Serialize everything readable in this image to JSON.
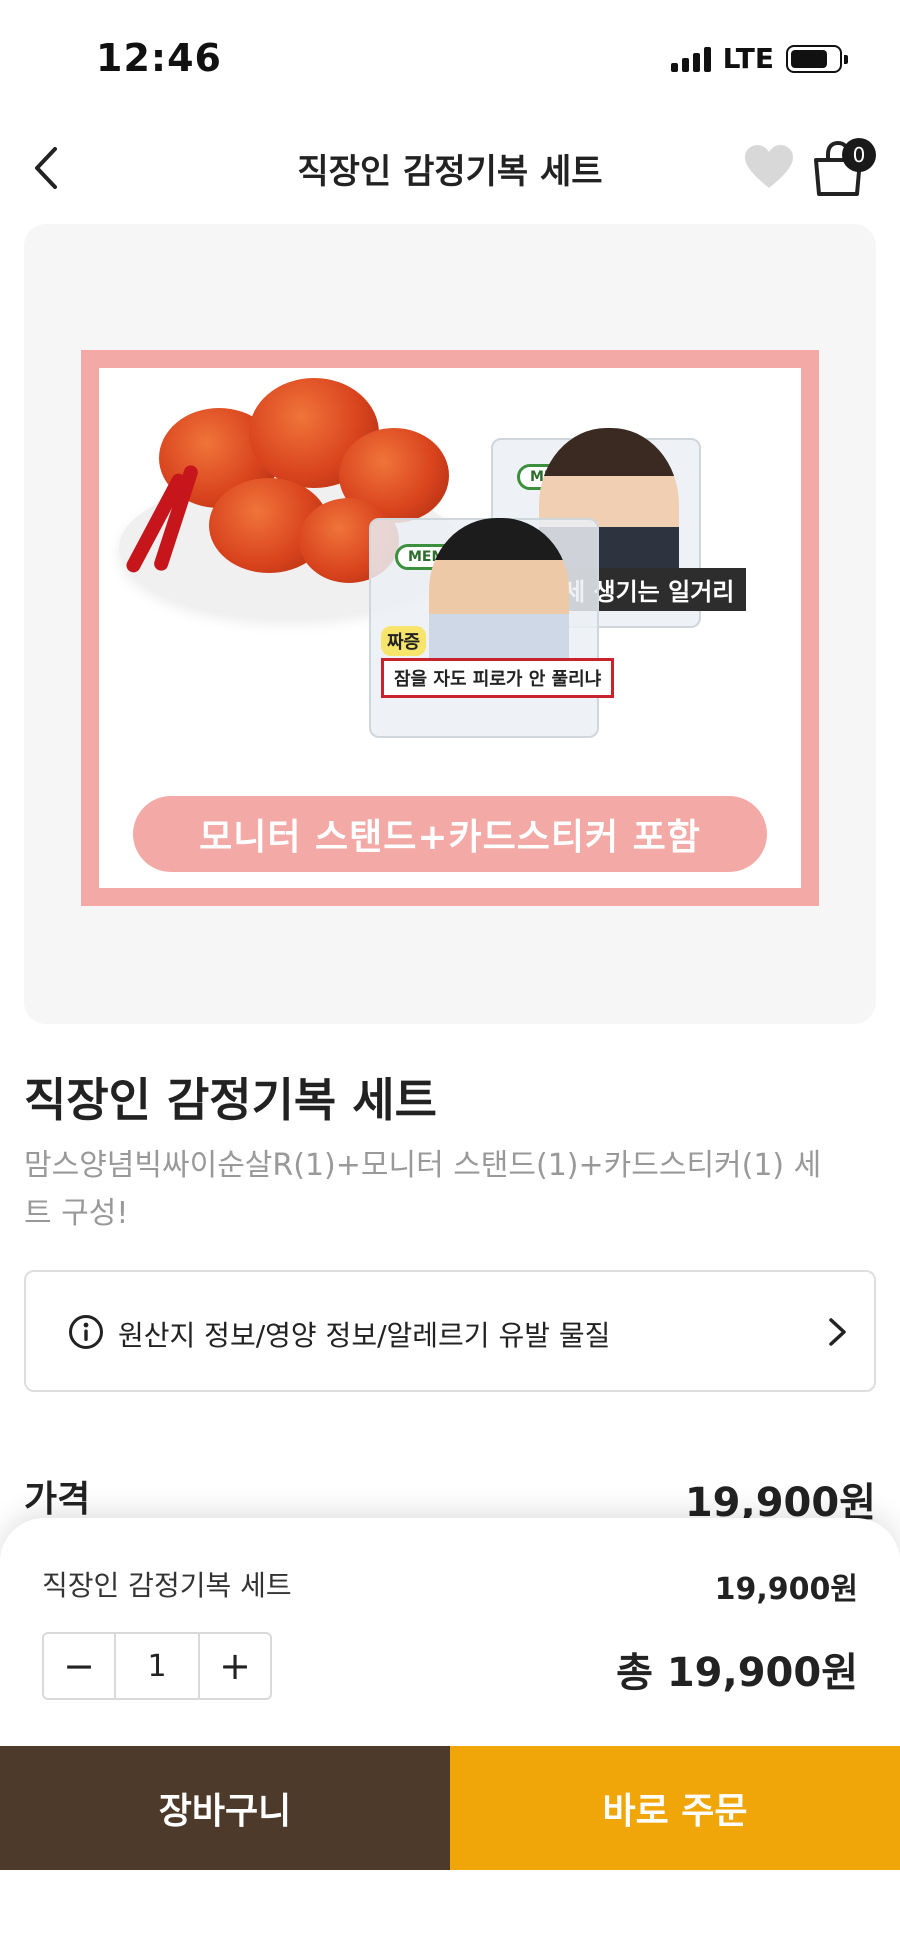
{
  "status_bar": {
    "time": "12:46",
    "network": "LTE"
  },
  "header": {
    "title": "직장인 감정기복 세트",
    "cart_count": "0"
  },
  "hero": {
    "memo_tag": "MEMO",
    "stand_label_1": "잠을 자도 피로가 안 풀리냐",
    "stand_badge_1": "짜증",
    "stand_label_2": "금세 생기는 일거리",
    "banner_text": "모니터 스탠드+카드스티커 포함",
    "colors": {
      "frame": "#f3aaa6"
    }
  },
  "product": {
    "name": "직장인 감정기복 세트",
    "description": "맘스양념빅싸이순살R(1)+모니터 스탠드(1)+카드스티커(1) 세트 구성!"
  },
  "info": {
    "label": "원산지 정보/영양 정보/알레르기 유발 물질"
  },
  "price": {
    "label": "가격",
    "value": "19,900원"
  },
  "sheet": {
    "item_name": "직장인 감정기복 세트",
    "unit_price": "19,900원",
    "minus": "−",
    "quantity": "1",
    "plus": "+",
    "total": "총 19,900원"
  },
  "actions": {
    "cart_label": "장바구니",
    "order_label": "바로 주문",
    "colors": {
      "cart": "#4d3a2b",
      "order": "#f0a509"
    }
  }
}
